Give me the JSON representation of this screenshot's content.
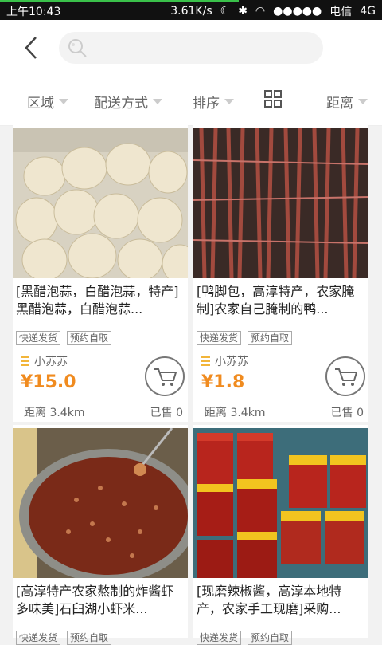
{
  "status": {
    "time": "上午10:43",
    "speed": "3.61K/s",
    "carrier": "电信",
    "network": "4G"
  },
  "header": {
    "search_placeholder": ""
  },
  "filters": [
    {
      "label": "区域"
    },
    {
      "label": "配送方式"
    },
    {
      "label": "排序"
    },
    {
      "label": "距离"
    }
  ],
  "products": [
    {
      "title": "[黑醋泡蒜，白醋泡蒜，特产]黑醋泡蒜，白醋泡蒜...",
      "tags": [
        "快递发货",
        "预约自取"
      ],
      "seller": "小苏苏",
      "price": "¥15.0",
      "distance": "距离 3.4km",
      "sold": "已售 0",
      "image": "garlic"
    },
    {
      "title": "[鸭脚包，高淳特产，农家腌制]农家自己腌制的鸭...",
      "tags": [
        "快递发货",
        "预约自取"
      ],
      "seller": "小苏苏",
      "price": "¥1.8",
      "distance": "距离 3.4km",
      "sold": "已售 0",
      "image": "duck-feet"
    },
    {
      "title": "[高淳特产农家熬制的炸酱虾多味美]石臼湖小虾米...",
      "tags": [
        "快递发货",
        "预约自取"
      ],
      "image": "shrimp-sauce"
    },
    {
      "title": "[现磨辣椒酱，高淳本地特产，农家手工现磨]采购...",
      "tags": [
        "快递发货",
        "预约自取"
      ],
      "image": "chili-sauce"
    }
  ]
}
